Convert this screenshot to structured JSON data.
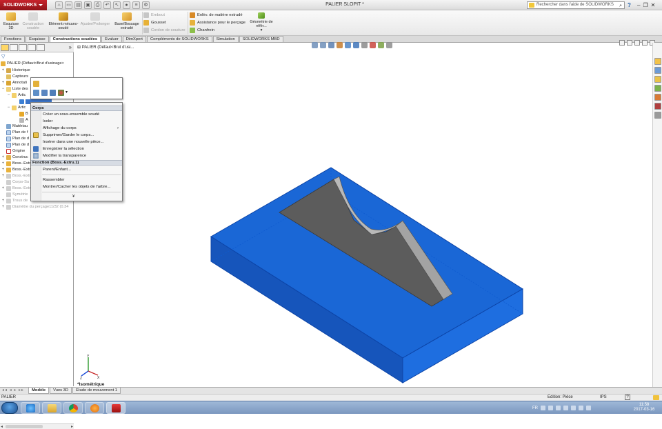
{
  "titlebar": {
    "app_name": "SOLIDWORKS",
    "window_title": "PALIER SLOPIT *",
    "search_placeholder": "Rechercher dans l'aide de SOLIDWORKS",
    "help_label": "?",
    "minimize": "–",
    "restore": "❐",
    "close": "✕"
  },
  "commands": {
    "esquisse": "Esquisse 3D",
    "construction_soudee": "Construction soudée",
    "element_mecano": "Elément mécano-soudé",
    "ajuster": "Ajuster/Prolonger",
    "base_bossage": "Base/Bossage extrudé",
    "embout": "Embout",
    "gousset": "Gousset",
    "cordon": "Cordon de soudure",
    "enlev": "Enlèv. de matière extrudé",
    "assistance": "Assistance pour le perçage",
    "chanfrein": "Chanfrein",
    "geometrie": "Géométrie de référ...",
    "geometrie_arrow": "▾"
  },
  "tabs": [
    "Fonctions",
    "Esquisse",
    "Constructions soudées",
    "Evaluer",
    "DimXpert",
    "Compléments de SOLIDWORKS",
    "Simulation",
    "SOLIDWORKS MBD"
  ],
  "active_tab": "Constructions soudées",
  "tree": {
    "root": "PALIER  (Défaut<Brut d'usinage>",
    "historique": "Historique",
    "capteurs": "Capteurs",
    "annotations": "Annotati",
    "liste": "Liste des",
    "artic1": "Artic",
    "artic2": "Artic",
    "b_item": "B",
    "a_item": "A",
    "materiau": "Matériau",
    "plan_face": "Plan de f",
    "plan_dessus": "Plan de d",
    "plan_droite": "Plan de d",
    "origine": "Origine",
    "construction": "Construc",
    "boss1": "Boss.-Extr",
    "boss2": "Boss.-Extr",
    "boss3": "Boss.-Extr",
    "corps": "Corps-Su",
    "boss4": "Boss.-Extr",
    "symetrie": "Symétrie",
    "trous": "Trous de",
    "diametre": "Diamètre du perçage11/32 (0.34"
  },
  "context_menu": {
    "section_corps": "Corps",
    "items_corps": [
      {
        "label": "Créer un sous-ensemble soudé",
        "icon": "none"
      },
      {
        "label": "Isoler",
        "icon": "none"
      },
      {
        "label": "Affichage du corps",
        "icon": "none",
        "submenu": true
      },
      {
        "label": "Supprimer/Garder le corps...",
        "icon": "delete-body-icon"
      },
      {
        "label": "Insérer dans une nouvelle pièce...",
        "icon": "none"
      },
      {
        "label": "Enregistrer la sélection",
        "icon": "save-selection-icon"
      },
      {
        "label": "Modifier la transparence",
        "icon": "transparency-icon"
      }
    ],
    "section_fonction": "Fonction (Boss.-Extru.1)",
    "items_fonction": [
      {
        "label": "Parent/Enfant..."
      },
      {
        "label": "Rassembler"
      },
      {
        "label": "Montrer/Cacher les objets de l'arbre..."
      }
    ],
    "expand_glyph": "¥",
    "submenu_arrow": "›"
  },
  "viewport": {
    "tree_flyout": "PALIER  (Défaut<Brut d'usi...",
    "view_name": "*Isométrique",
    "plate_color": "#1a67d6",
    "plate_edge": "#0d45a8",
    "gusset_color": "#5c5c5c"
  },
  "bottom_tabs": [
    "Modèle",
    "Vues 3D",
    "Etude de mouvement 1"
  ],
  "bottom_nav": "◂◂ ◂ ▸ ▸▸",
  "status": {
    "left": "PALIER",
    "mode": "Edition: Pièce",
    "units": "IPS",
    "help": "?"
  },
  "taskbar": {
    "lang": "FR",
    "time": "11:58",
    "date": "2017-03-16"
  }
}
